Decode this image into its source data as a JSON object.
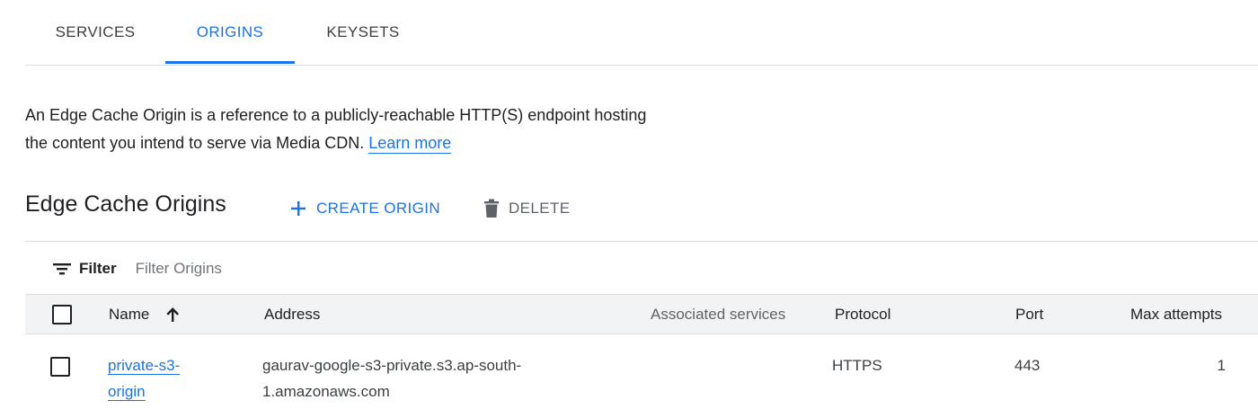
{
  "tabs": [
    {
      "label": "SERVICES",
      "active": false
    },
    {
      "label": "ORIGINS",
      "active": true
    },
    {
      "label": "KEYSETS",
      "active": false
    }
  ],
  "description": {
    "line1": "An Edge Cache Origin is a reference to a publicly-reachable HTTP(S) endpoint hosting",
    "line2": "the content you intend to serve via Media CDN.",
    "link": "Learn more"
  },
  "section": {
    "title": "Edge Cache Origins",
    "create_label": "CREATE ORIGIN",
    "delete_label": "DELETE"
  },
  "filter": {
    "label": "Filter",
    "placeholder": "Filter Origins"
  },
  "table": {
    "columns": {
      "name": "Name",
      "address": "Address",
      "associated_services": "Associated services",
      "protocol": "Protocol",
      "port": "Port",
      "max_attempts": "Max attempts"
    },
    "sort": {
      "column": "name",
      "direction": "ascending"
    },
    "rows": [
      {
        "name_line1": "private-s3-",
        "name_line2": "origin",
        "address_line1": "gaurav-google-s3-private.s3.ap-south-",
        "address_line2": "1.amazonaws.com",
        "associated_services": "",
        "protocol": "HTTPS",
        "port": "443",
        "max_attempts": "1"
      }
    ]
  },
  "colors": {
    "accent": "#1a73e8",
    "text": "#202124",
    "muted": "#5f6368",
    "header_bg": "#f1f3f4",
    "divider": "#dadce0"
  }
}
